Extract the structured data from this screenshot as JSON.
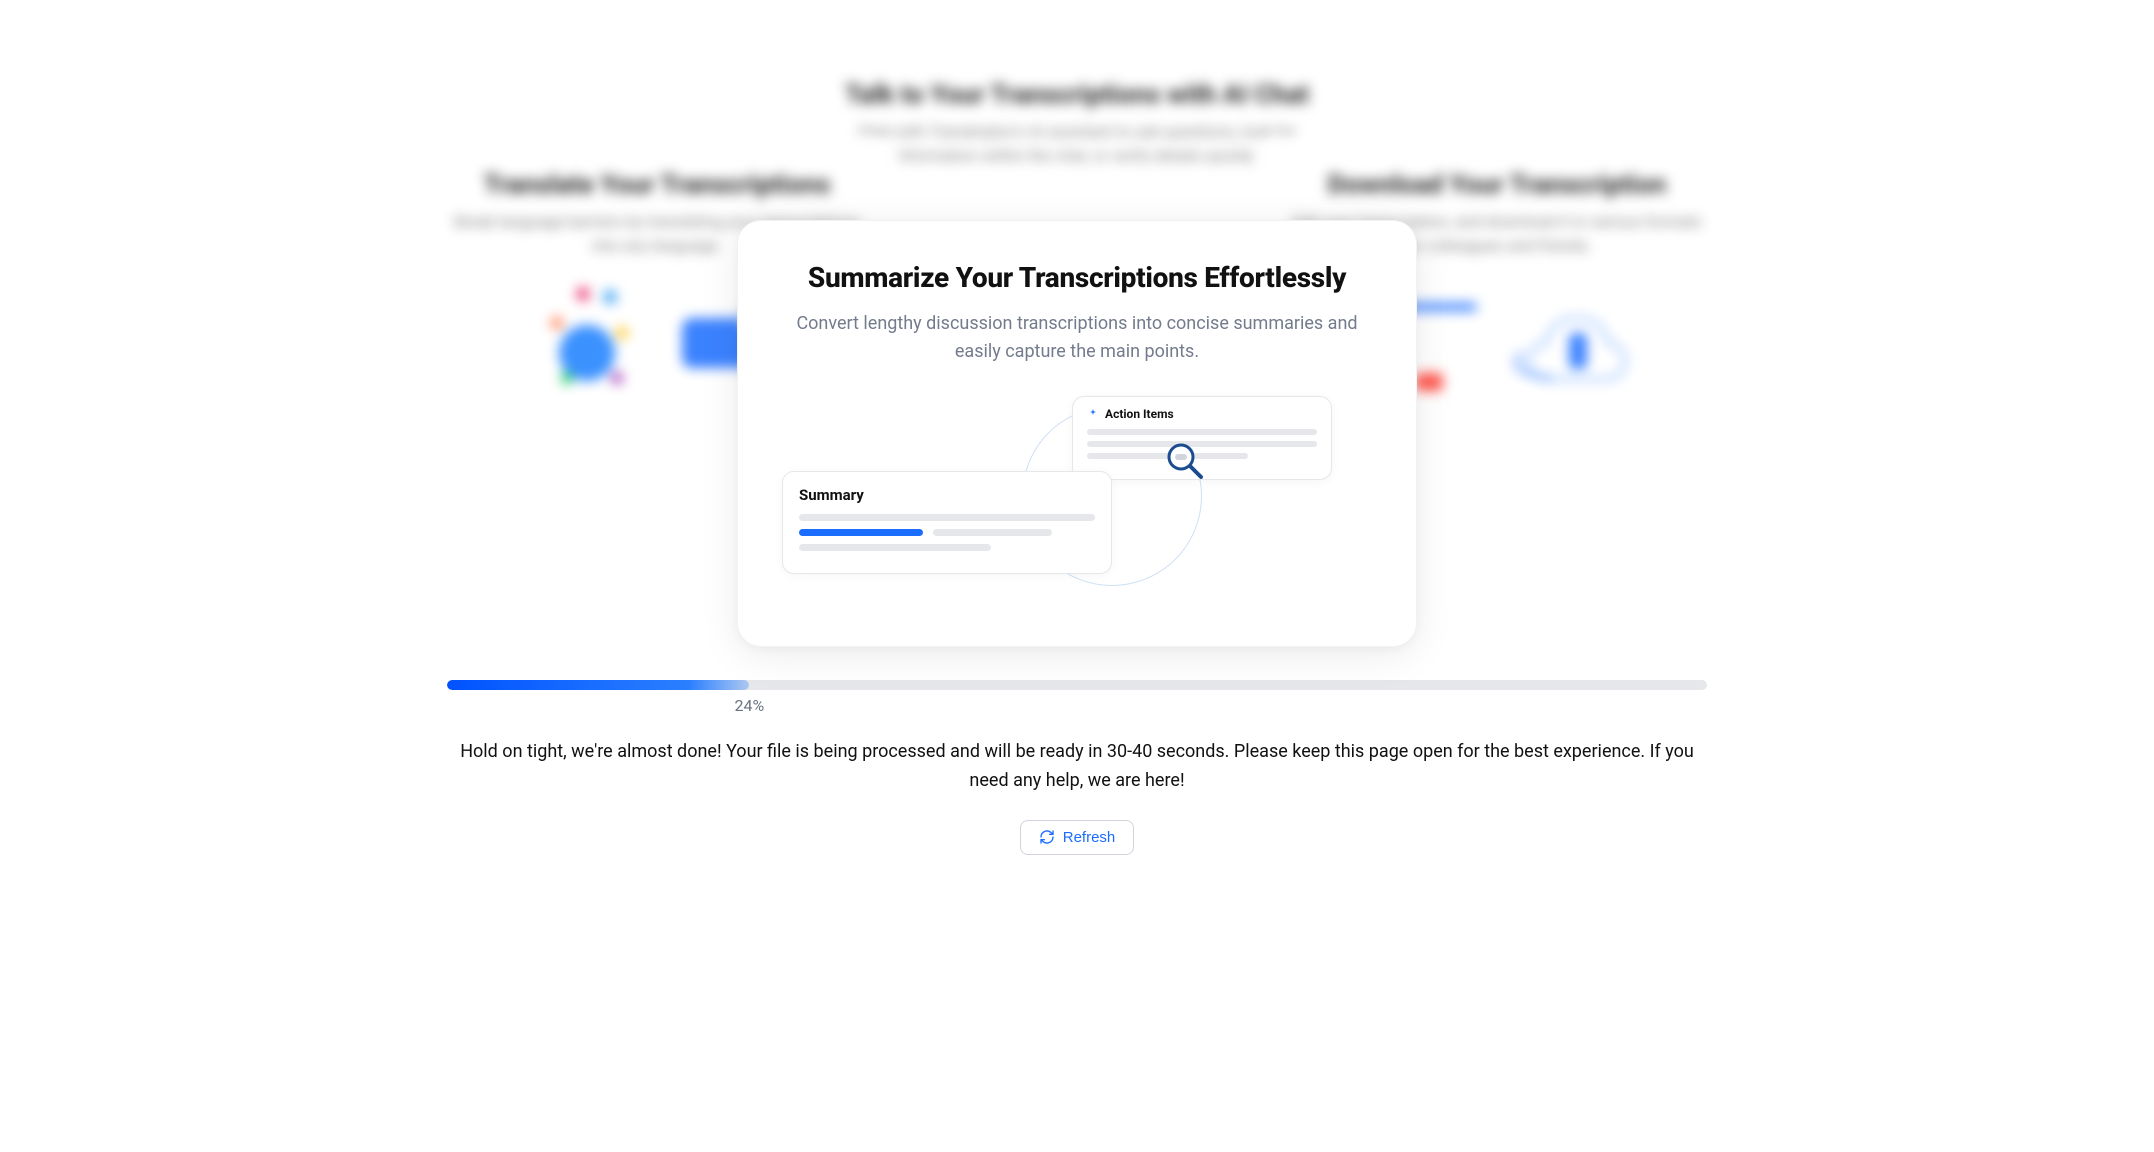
{
  "background_cards": {
    "left": {
      "title": "Translate Your Transcriptions",
      "subtitle": "Break language barriers by translating your transcriptions into any language."
    },
    "top": {
      "title": "Talk to Your Transcriptions with AI Chat",
      "subtitle": "Chat with Transkriptor's AI assistant to ask questions, look for information within the chat, or verify details quickly."
    },
    "right": {
      "title": "Download Your Transcription",
      "subtitle": "Edit your transcription, and download it in various formats for colleagues and friends."
    }
  },
  "main_card": {
    "title": "Summarize Your Transcriptions Effortlessly",
    "subtitle": "Convert lengthy discussion transcriptions into concise summaries and easily capture the main points.",
    "action_items_label": "Action Items",
    "summary_label": "Summary"
  },
  "progress": {
    "percent": 24,
    "percent_label": "24%"
  },
  "status_text": "Hold on tight, we're almost done! Your file is being processed and will be ready in 30-40 seconds. Please keep this page open for the best experience. If you need any help, we are here!",
  "refresh_label": "Refresh"
}
